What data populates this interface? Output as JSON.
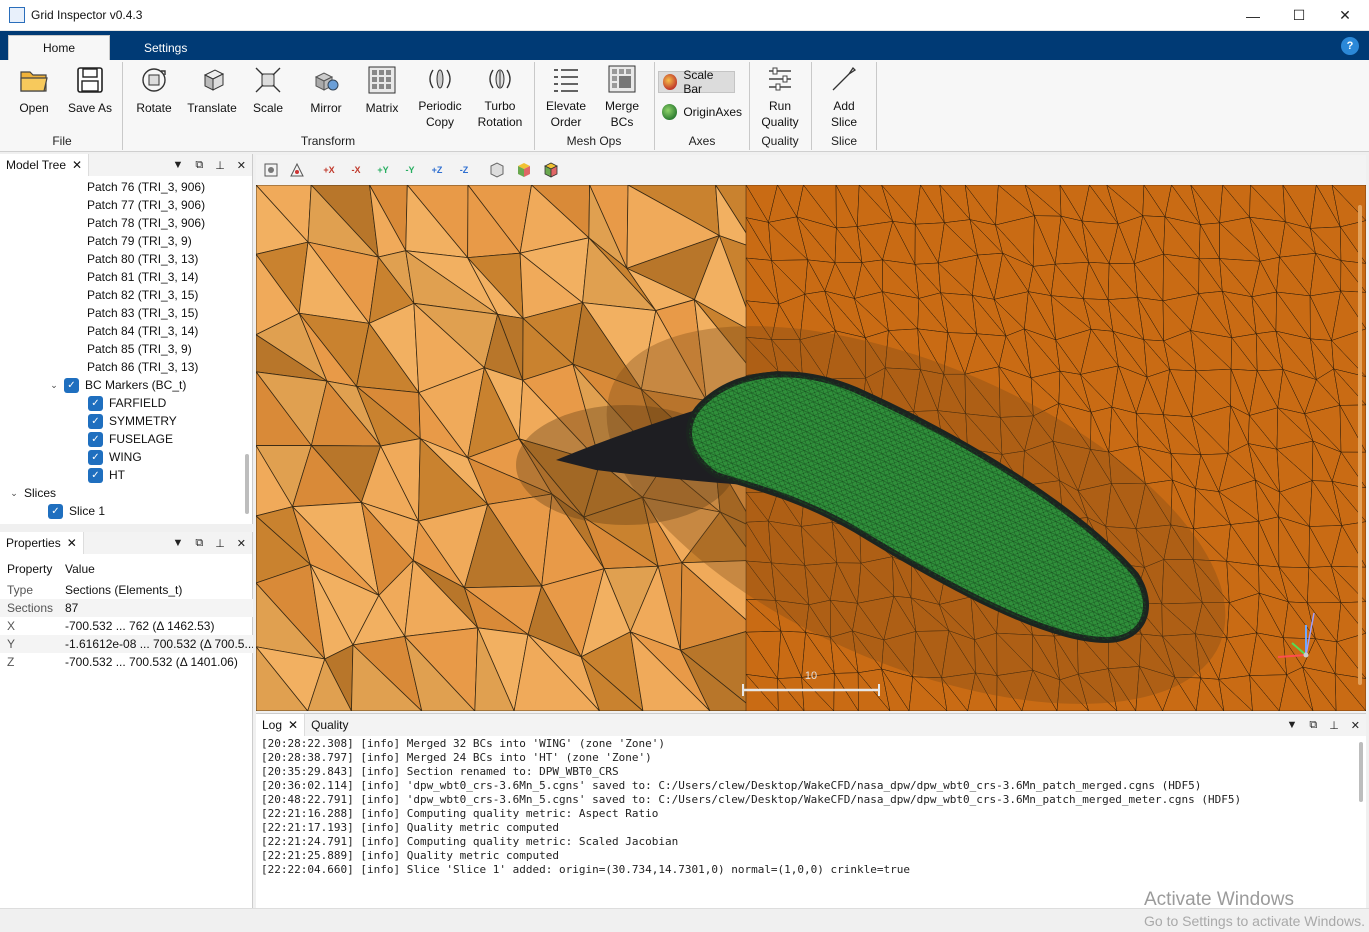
{
  "window": {
    "title": "Grid Inspector  v0.4.3",
    "min": "—",
    "max": "☐",
    "close": "✕"
  },
  "ribbon_tabs": [
    {
      "label": "Home"
    },
    {
      "label": "Settings"
    }
  ],
  "help": "?",
  "ribbon": {
    "file": {
      "label": "File",
      "open": "Open",
      "save_as": "Save As"
    },
    "transform": {
      "label": "Transform",
      "rotate": "Rotate",
      "translate": "Translate",
      "scale": "Scale",
      "mirror": "Mirror",
      "matrix": "Matrix",
      "periodic_copy_1": "Periodic",
      "periodic_copy_2": "Copy",
      "turbo_rotation_1": "Turbo",
      "turbo_rotation_2": "Rotation"
    },
    "mesh_ops": {
      "label": "Mesh Ops",
      "elevate_1": "Elevate",
      "elevate_2": "Order",
      "merge_1": "Merge",
      "merge_2": "BCs"
    },
    "axes": {
      "label": "Axes",
      "scale_bar": "Scale Bar",
      "origin_axes": "OriginAxes"
    },
    "quality": {
      "label": "Quality",
      "run_1": "Run",
      "run_2": "Quality"
    },
    "slice": {
      "label": "Slice",
      "add_1": "Add",
      "add_2": "Slice"
    }
  },
  "model_tree": {
    "title": "Model Tree",
    "patches": [
      "Patch  76 (TRI_3, 906)",
      "Patch  77 (TRI_3, 906)",
      "Patch  78 (TRI_3, 906)",
      "Patch  79 (TRI_3, 9)",
      "Patch  80 (TRI_3, 13)",
      "Patch  81 (TRI_3, 14)",
      "Patch  82 (TRI_3, 15)",
      "Patch  83 (TRI_3, 15)",
      "Patch  84 (TRI_3, 14)",
      "Patch  85 (TRI_3, 9)",
      "Patch  86 (TRI_3, 13)"
    ],
    "bc_markers": "BC Markers (BC_t)",
    "bcs": [
      "FARFIELD",
      "SYMMETRY",
      "FUSELAGE",
      "WING",
      "HT"
    ],
    "slices": "Slices",
    "slice_items": [
      "Slice 1"
    ]
  },
  "properties": {
    "title": "Properties",
    "col_property": "Property",
    "col_value": "Value",
    "rows": [
      {
        "key": "Type",
        "value": "Sections (Elements_t)"
      },
      {
        "key": "Sections",
        "value": "87"
      },
      {
        "key": "X",
        "value": "-700.532 ... 762  (Δ 1462.53)"
      },
      {
        "key": "Y",
        "value": "-1.61612e-08 ... 700.532  (Δ 700.5..."
      },
      {
        "key": "Z",
        "value": "-700.532 ... 700.532  (Δ 1401.06)"
      }
    ]
  },
  "viewport": {
    "scale_bar_label": "10"
  },
  "viewer_toolbar": [
    "+X",
    "-X",
    "+Y",
    "-Y",
    "+Z",
    "-Z"
  ],
  "log": {
    "tabs": [
      "Log",
      "Quality"
    ],
    "lines": [
      "[20:28:22.308] [info] Merged 32 BCs into 'WING' (zone 'Zone')",
      "[20:28:38.797] [info] Merged 24 BCs into 'HT' (zone 'Zone')",
      "[20:35:29.843] [info] Section renamed to: DPW_WBT0_CRS",
      "[20:36:02.114] [info] 'dpw_wbt0_crs-3.6Mn_5.cgns' saved to: C:/Users/clew/Desktop/WakeCFD/nasa_dpw/dpw_wbt0_crs-3.6Mn_patch_merged.cgns (HDF5)",
      "[20:48:22.791] [info] 'dpw_wbt0_crs-3.6Mn_5.cgns' saved to: C:/Users/clew/Desktop/WakeCFD/nasa_dpw/dpw_wbt0_crs-3.6Mn_patch_merged_meter.cgns (HDF5)",
      "[22:21:16.288] [info] Computing quality metric: Aspect Ratio",
      "[22:21:17.193] [info] Quality metric computed",
      "[22:21:24.791] [info] Computing quality metric: Scaled Jacobian",
      "[22:21:25.889] [info] Quality metric computed",
      "[22:22:04.660] [info] Slice 'Slice 1' added: origin=(30.734,14.7301,0) normal=(1,0,0) crinkle=true"
    ]
  },
  "watermark": {
    "line1": "Activate Windows",
    "line2": "Go to Settings to activate Windows."
  },
  "colors": {
    "ribbon_blue": "#003a75",
    "mesh_light": "#e89a48",
    "mesh_dark": "#c96b14",
    "body_green": "#2e8b36"
  }
}
